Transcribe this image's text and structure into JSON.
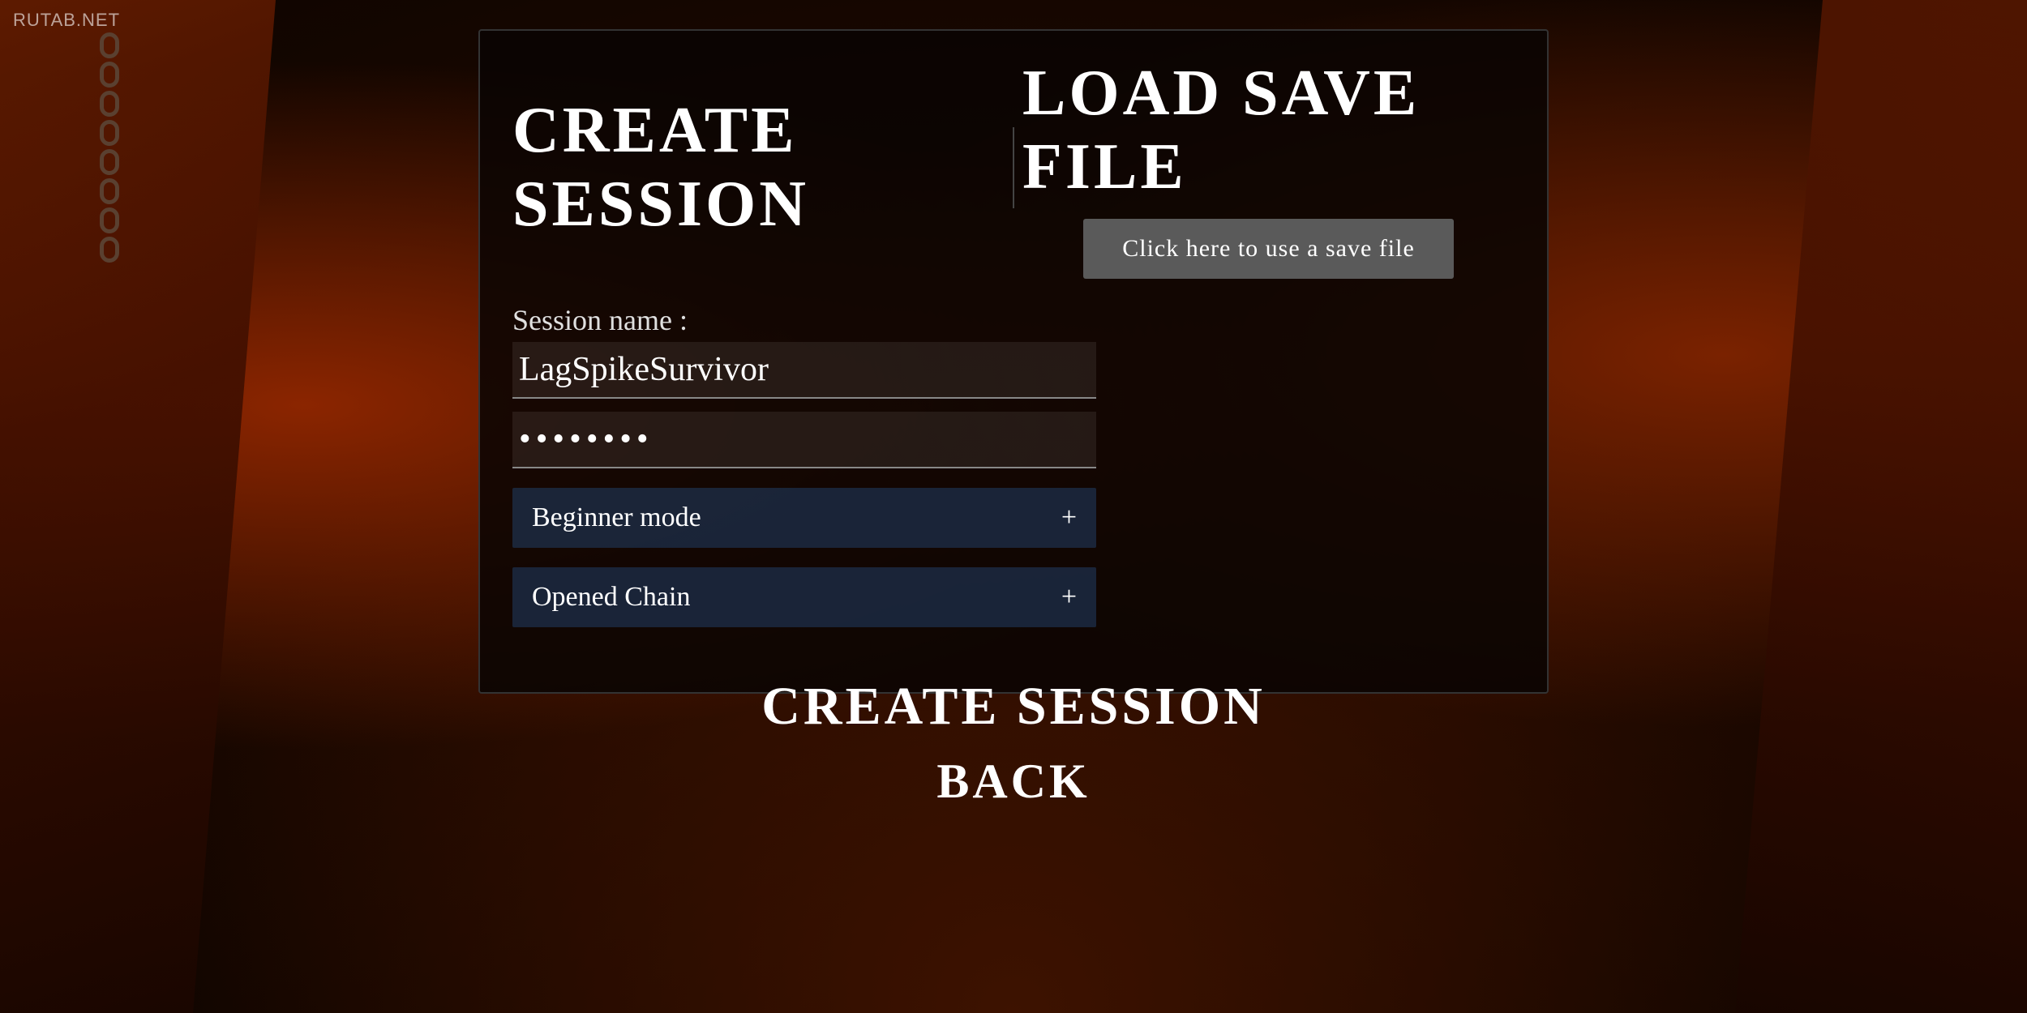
{
  "watermark": {
    "text": "RUTAB.NET"
  },
  "header": {
    "create_title": "Create Session",
    "load_title": "Load Save File",
    "load_save_btn": "Click here to use a save file"
  },
  "form": {
    "session_name_label": "Session name :",
    "session_name_value": "LagSpikeSurvivor",
    "password_value": "••••••••",
    "beginner_mode_label": "Beginner mode",
    "opened_chain_label": "Opened Chain",
    "plus_icon_1": "+",
    "plus_icon_2": "+"
  },
  "footer": {
    "create_btn": "Create Session",
    "back_btn": "Back"
  },
  "chain": {
    "links": [
      1,
      2,
      3,
      4,
      5,
      6,
      7,
      8
    ]
  }
}
